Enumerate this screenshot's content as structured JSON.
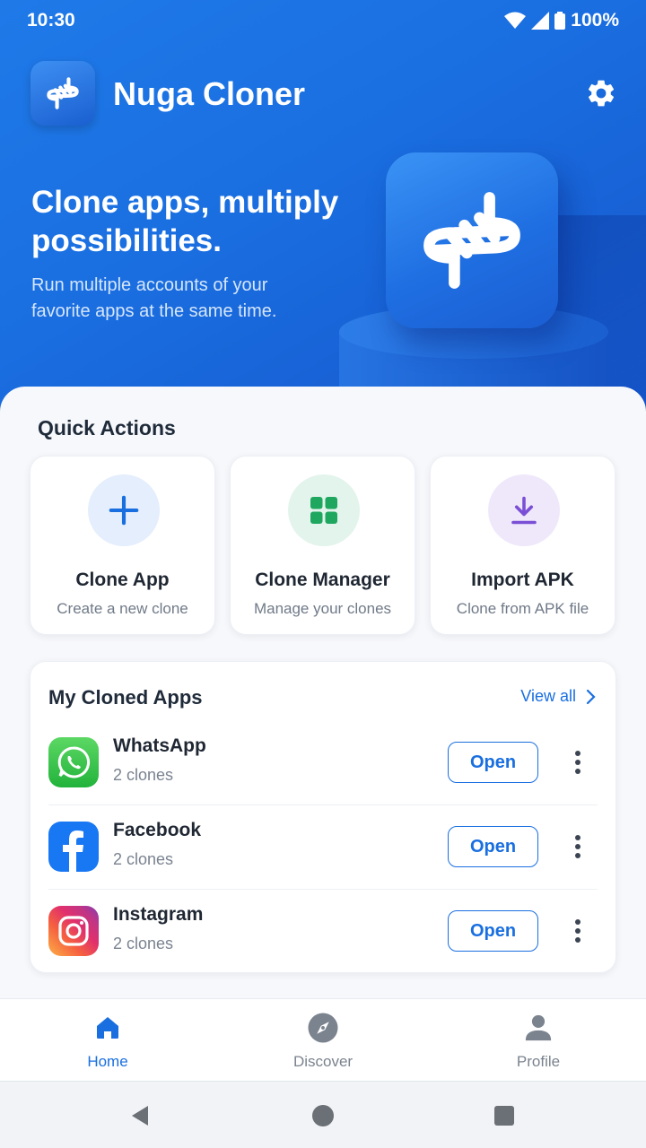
{
  "status_bar": {
    "time": "10:30",
    "battery": "100%"
  },
  "header": {
    "app_name": "Nuga Cloner",
    "logo_icon": "cloner-logo-icon",
    "settings_icon": "gear-icon"
  },
  "hero": {
    "headline": "Clone apps, multiply possibilities.",
    "subline": "Run multiple accounts of your favorite apps at the same time."
  },
  "quick_actions": {
    "title": "Quick Actions",
    "items": [
      {
        "label": "Clone App",
        "sub": "Create a new clone",
        "icon": "plus-icon",
        "color": "#1a6fe0"
      },
      {
        "label": "Clone Manager",
        "sub": "Manage your clones",
        "icon": "grid-icon",
        "color": "#1fa760"
      },
      {
        "label": "Import APK",
        "sub": "Clone from APK file",
        "icon": "download-icon",
        "color": "#7a4fd6"
      }
    ]
  },
  "cloned_apps": {
    "title": "My Cloned Apps",
    "view_all": "View all",
    "items": [
      {
        "name": "WhatsApp",
        "count": "2 clones",
        "button": "Open",
        "icon": "whatsapp-icon"
      },
      {
        "name": "Facebook",
        "count": "2 clones",
        "button": "Open",
        "icon": "facebook-icon"
      },
      {
        "name": "Instagram",
        "count": "2 clones",
        "button": "Open",
        "icon": "instagram-icon"
      }
    ]
  },
  "bottom_nav": {
    "items": [
      {
        "label": "Home",
        "icon": "home-icon",
        "active": true
      },
      {
        "label": "Discover",
        "icon": "compass-icon",
        "active": false
      },
      {
        "label": "Profile",
        "icon": "person-icon",
        "active": false
      }
    ]
  },
  "colors": {
    "accent": "#1a6fe0",
    "hero_bg": "#1a6ee0"
  }
}
